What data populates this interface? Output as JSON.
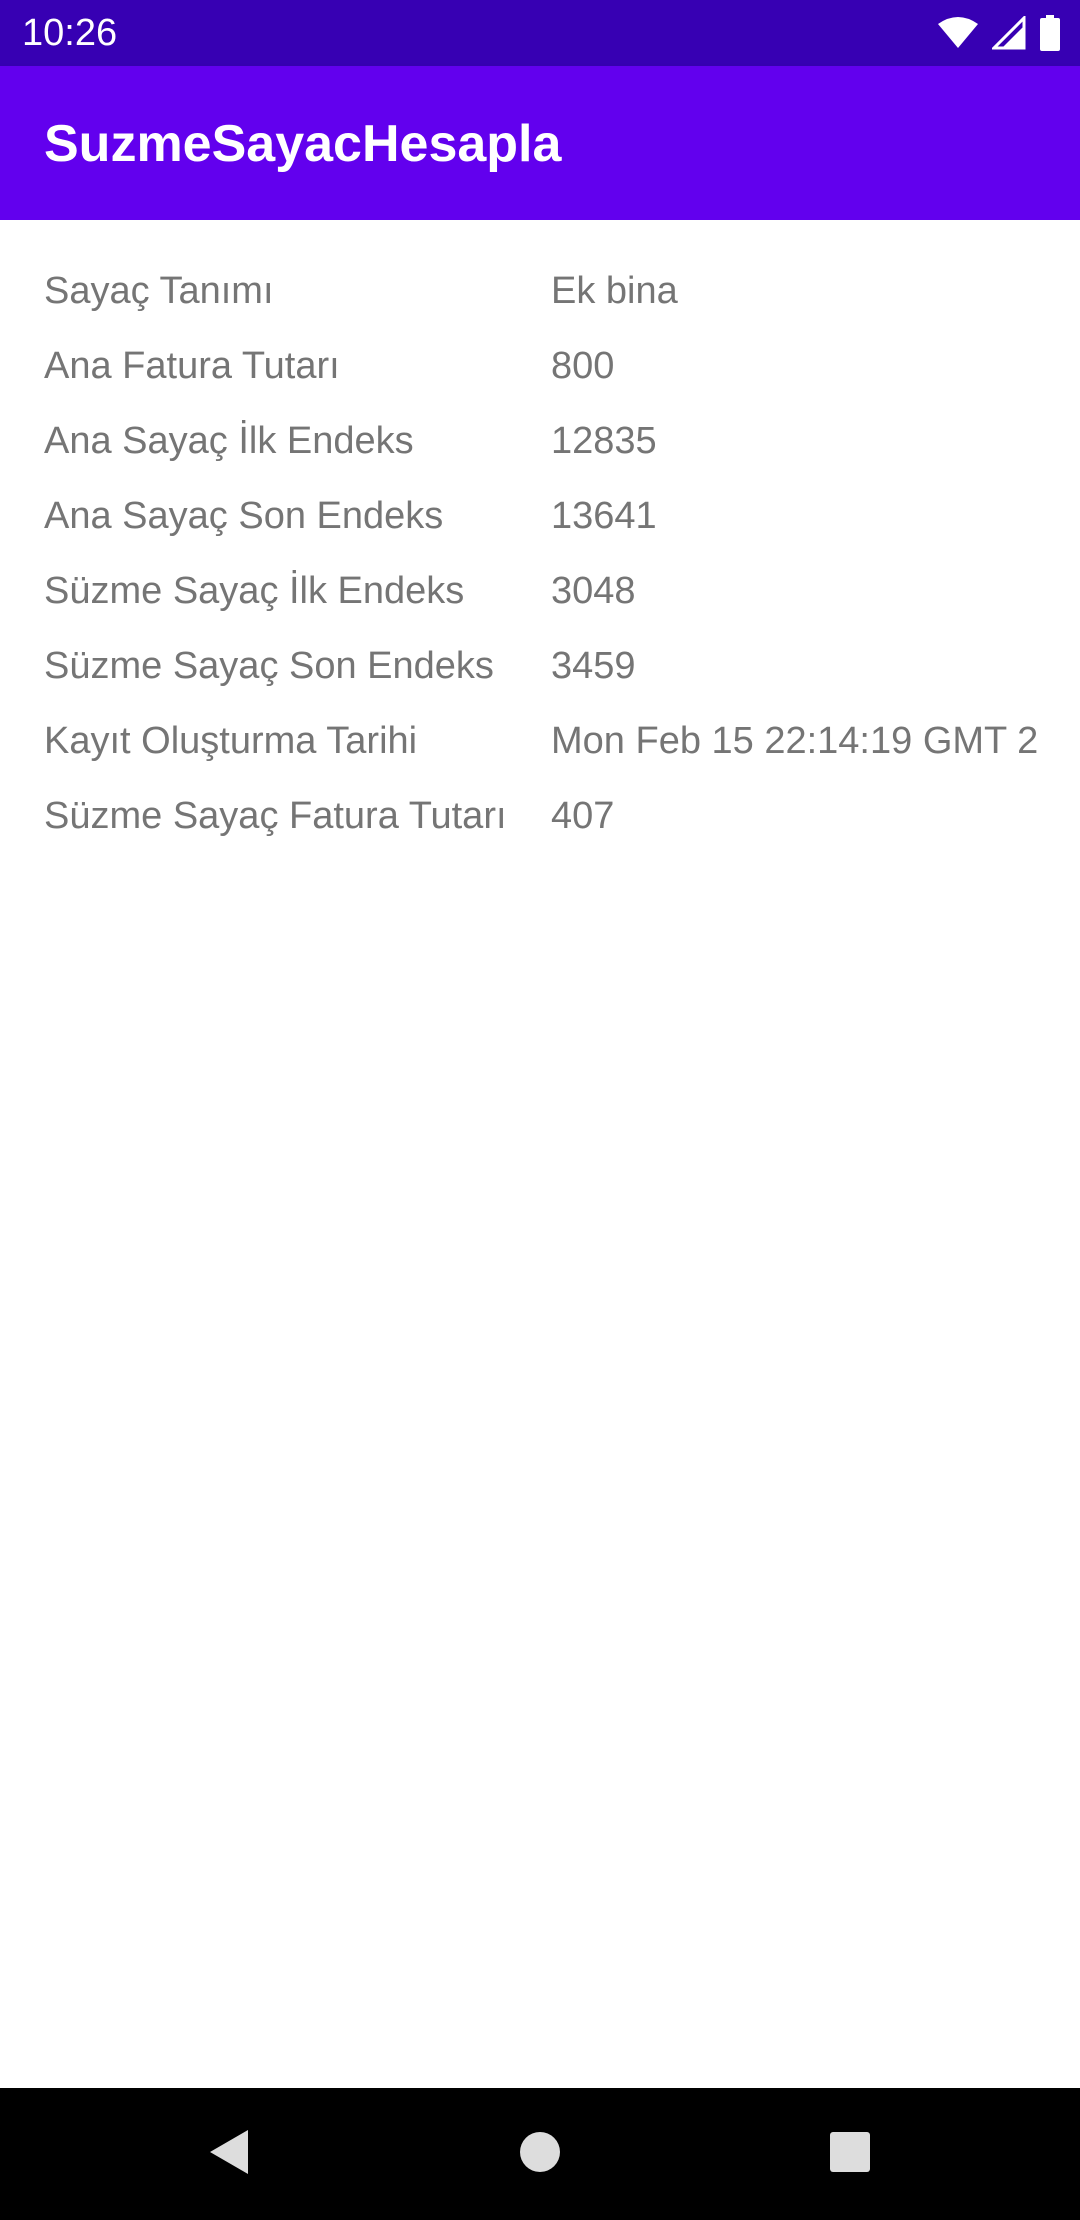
{
  "status_bar": {
    "time": "10:26",
    "icons": [
      "wifi-icon",
      "cellular-signal-icon",
      "battery-icon"
    ]
  },
  "app_bar": {
    "title": "SuzmeSayacHesapla",
    "background": "#6200ee"
  },
  "details": [
    {
      "label": "Sayaç Tanımı",
      "value": "Ek bina"
    },
    {
      "label": "Ana Fatura Tutarı",
      "value": "800"
    },
    {
      "label": "Ana Sayaç İlk Endeks",
      "value": "12835"
    },
    {
      "label": "Ana Sayaç Son Endeks",
      "value": "13641"
    },
    {
      "label": "Süzme Sayaç İlk Endeks",
      "value": "3048"
    },
    {
      "label": "Süzme Sayaç Son Endeks",
      "value": "3459"
    },
    {
      "label": "Kayıt Oluşturma Tarihi",
      "value": "Mon Feb 15 22:14:19 GMT 2"
    },
    {
      "label": "Süzme Sayaç Fatura Tutarı",
      "value": "407"
    }
  ],
  "nav_bar": {
    "buttons": [
      "back-icon",
      "home-icon",
      "recents-icon"
    ]
  }
}
